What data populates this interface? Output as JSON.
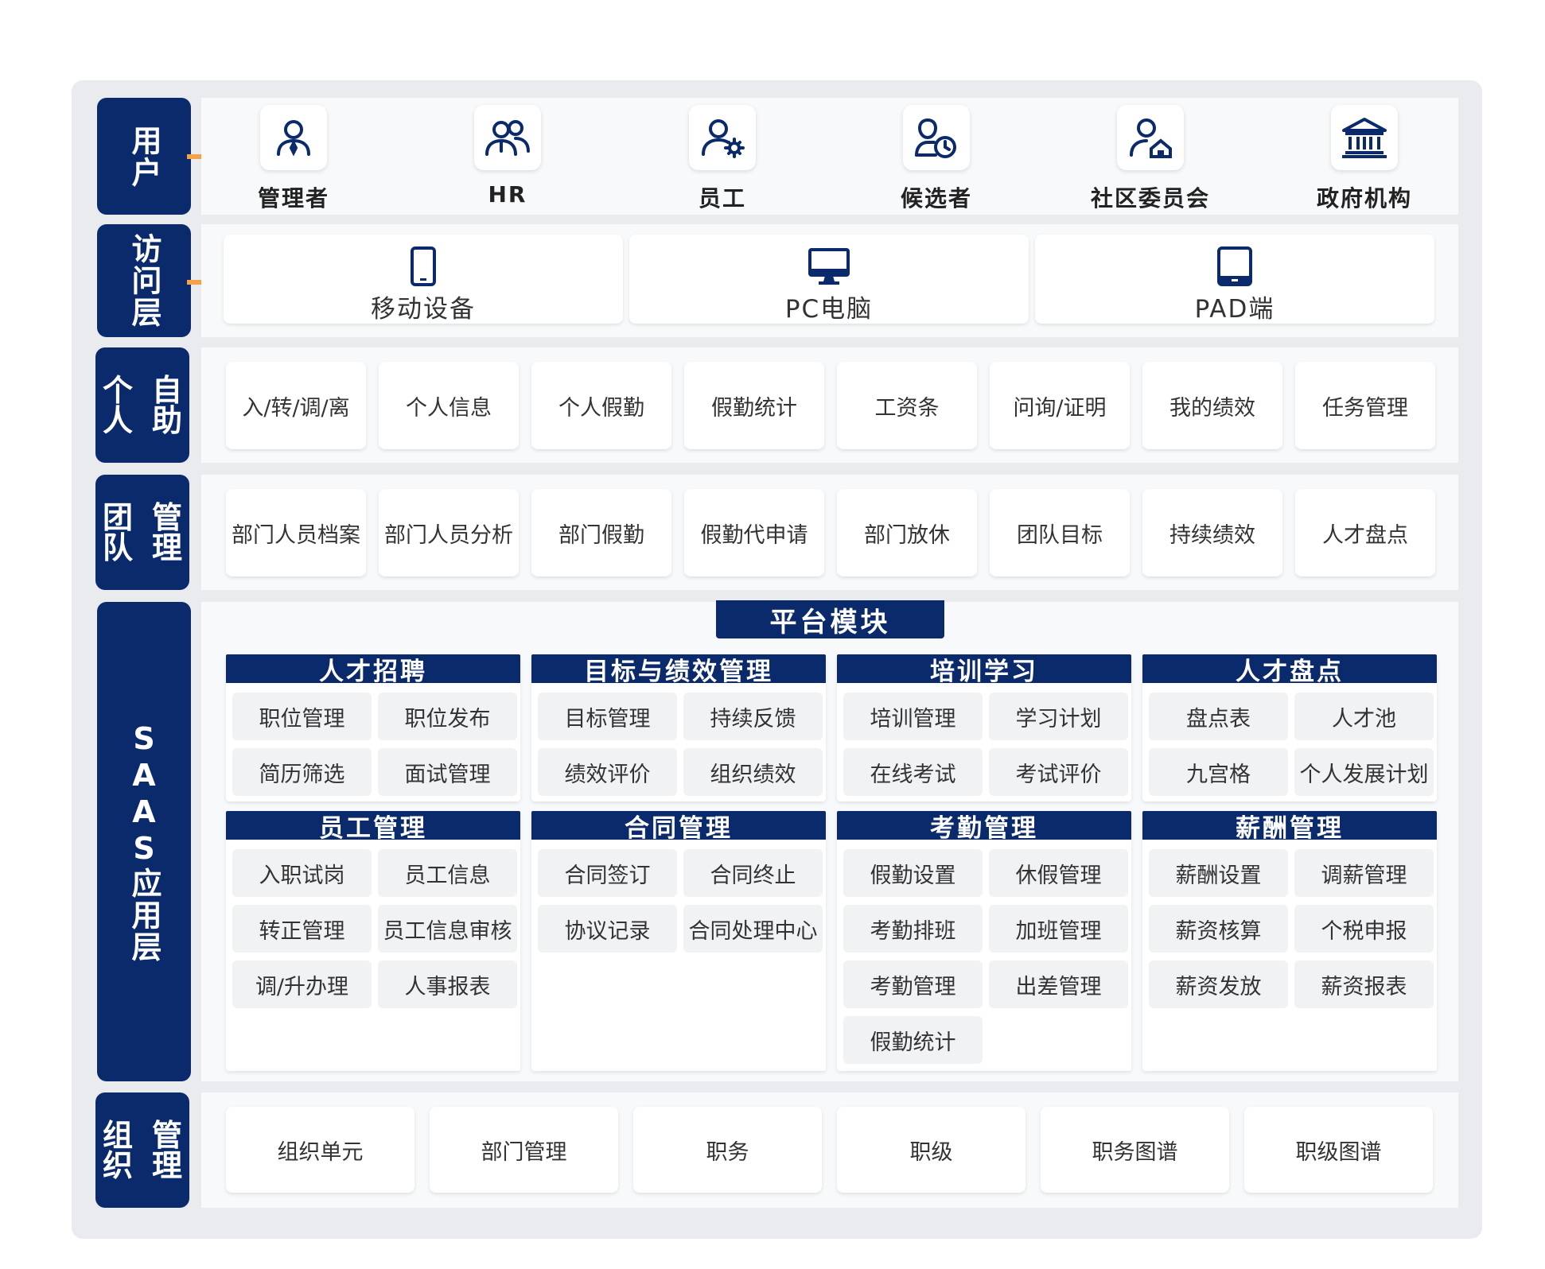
{
  "colors": {
    "navy": "#0a2a6b",
    "arrow": "#f5a34a",
    "panel": "#f8f9fb",
    "frame": "#e9ebef"
  },
  "layers": {
    "users": "用户",
    "access": "访问层",
    "self_service": [
      "自助",
      "个人"
    ],
    "team_mgmt": [
      "管理",
      "团队"
    ],
    "saas": "SAAS应用层",
    "org_mgmt": [
      "管理",
      "组织"
    ]
  },
  "users": [
    {
      "label": "管理者",
      "icon": "admin-user-icon"
    },
    {
      "label": "HR",
      "icon": "hr-group-icon"
    },
    {
      "label": "员工",
      "icon": "employee-gear-icon"
    },
    {
      "label": "候选者",
      "icon": "candidate-clock-icon"
    },
    {
      "label": "社区委员会",
      "icon": "community-home-icon"
    },
    {
      "label": "政府机构",
      "icon": "government-building-icon"
    }
  ],
  "access": [
    {
      "label": "移动设备",
      "icon": "mobile-icon"
    },
    {
      "label": "PC电脑",
      "icon": "monitor-icon"
    },
    {
      "label": "PAD端",
      "icon": "tablet-icon"
    }
  ],
  "self_service": [
    "入/转/调/离",
    "个人信息",
    "个人假勤",
    "假勤统计",
    "工资条",
    "问询/证明",
    "我的绩效",
    "任务管理"
  ],
  "team": [
    "部门人员档案",
    "部门人员分析",
    "部门假勤",
    "假勤代申请",
    "部门放休",
    "团队目标",
    "持续绩效",
    "人才盘点"
  ],
  "platform_title": "平台模块",
  "modules_row1": [
    {
      "title": "人才招聘",
      "items": [
        "职位管理",
        "职位发布",
        "简历筛选",
        "面试管理"
      ]
    },
    {
      "title": "目标与绩效管理",
      "items": [
        "目标管理",
        "持续反馈",
        "绩效评价",
        "组织绩效"
      ]
    },
    {
      "title": "培训学习",
      "items": [
        "培训管理",
        "学习计划",
        "在线考试",
        "考试评价"
      ]
    },
    {
      "title": "人才盘点",
      "items": [
        "盘点表",
        "人才池",
        "九宫格",
        "个人发展计划"
      ]
    }
  ],
  "modules_row2": [
    {
      "title": "员工管理",
      "items": [
        "入职试岗",
        "员工信息",
        "转正管理",
        "员工信息审核",
        "调/升办理",
        "人事报表"
      ]
    },
    {
      "title": "合同管理",
      "items": [
        "合同签订",
        "合同终止",
        "协议记录",
        "合同处理中心"
      ]
    },
    {
      "title": "考勤管理",
      "items": [
        "假勤设置",
        "休假管理",
        "考勤排班",
        "加班管理",
        "考勤管理",
        "出差管理",
        "假勤统计"
      ]
    },
    {
      "title": "薪酬管理",
      "items": [
        "薪酬设置",
        "调薪管理",
        "薪资核算",
        "个税申报",
        "薪资发放",
        "薪资报表"
      ]
    }
  ],
  "org": [
    "组织单元",
    "部门管理",
    "职务",
    "职级",
    "职务图谱",
    "职级图谱"
  ]
}
